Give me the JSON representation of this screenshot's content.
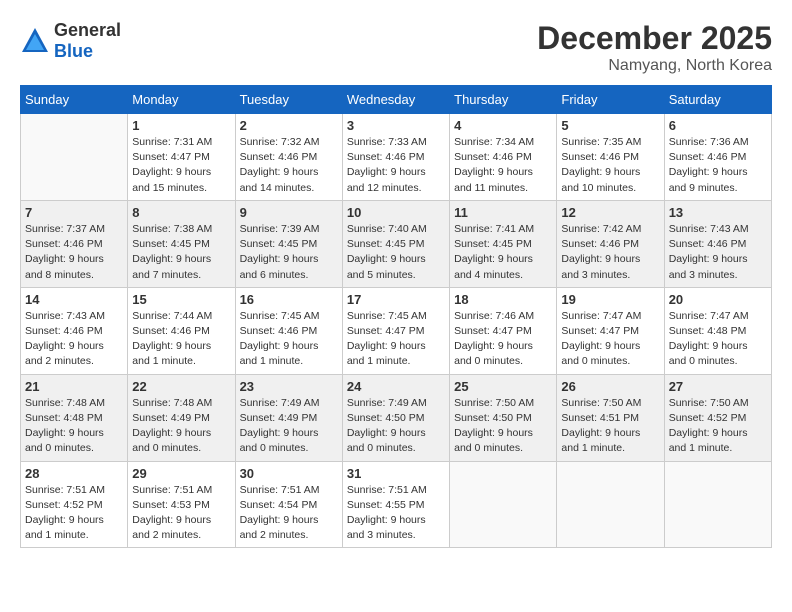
{
  "header": {
    "logo_line1": "General",
    "logo_line2": "Blue",
    "month_title": "December 2025",
    "location": "Namyang, North Korea"
  },
  "weekdays": [
    "Sunday",
    "Monday",
    "Tuesday",
    "Wednesday",
    "Thursday",
    "Friday",
    "Saturday"
  ],
  "weeks": [
    [
      {
        "day": "",
        "info": ""
      },
      {
        "day": "1",
        "info": "Sunrise: 7:31 AM\nSunset: 4:47 PM\nDaylight: 9 hours\nand 15 minutes."
      },
      {
        "day": "2",
        "info": "Sunrise: 7:32 AM\nSunset: 4:46 PM\nDaylight: 9 hours\nand 14 minutes."
      },
      {
        "day": "3",
        "info": "Sunrise: 7:33 AM\nSunset: 4:46 PM\nDaylight: 9 hours\nand 12 minutes."
      },
      {
        "day": "4",
        "info": "Sunrise: 7:34 AM\nSunset: 4:46 PM\nDaylight: 9 hours\nand 11 minutes."
      },
      {
        "day": "5",
        "info": "Sunrise: 7:35 AM\nSunset: 4:46 PM\nDaylight: 9 hours\nand 10 minutes."
      },
      {
        "day": "6",
        "info": "Sunrise: 7:36 AM\nSunset: 4:46 PM\nDaylight: 9 hours\nand 9 minutes."
      }
    ],
    [
      {
        "day": "7",
        "info": "Sunrise: 7:37 AM\nSunset: 4:46 PM\nDaylight: 9 hours\nand 8 minutes."
      },
      {
        "day": "8",
        "info": "Sunrise: 7:38 AM\nSunset: 4:45 PM\nDaylight: 9 hours\nand 7 minutes."
      },
      {
        "day": "9",
        "info": "Sunrise: 7:39 AM\nSunset: 4:45 PM\nDaylight: 9 hours\nand 6 minutes."
      },
      {
        "day": "10",
        "info": "Sunrise: 7:40 AM\nSunset: 4:45 PM\nDaylight: 9 hours\nand 5 minutes."
      },
      {
        "day": "11",
        "info": "Sunrise: 7:41 AM\nSunset: 4:45 PM\nDaylight: 9 hours\nand 4 minutes."
      },
      {
        "day": "12",
        "info": "Sunrise: 7:42 AM\nSunset: 4:46 PM\nDaylight: 9 hours\nand 3 minutes."
      },
      {
        "day": "13",
        "info": "Sunrise: 7:43 AM\nSunset: 4:46 PM\nDaylight: 9 hours\nand 3 minutes."
      }
    ],
    [
      {
        "day": "14",
        "info": "Sunrise: 7:43 AM\nSunset: 4:46 PM\nDaylight: 9 hours\nand 2 minutes."
      },
      {
        "day": "15",
        "info": "Sunrise: 7:44 AM\nSunset: 4:46 PM\nDaylight: 9 hours\nand 1 minute."
      },
      {
        "day": "16",
        "info": "Sunrise: 7:45 AM\nSunset: 4:46 PM\nDaylight: 9 hours\nand 1 minute."
      },
      {
        "day": "17",
        "info": "Sunrise: 7:45 AM\nSunset: 4:47 PM\nDaylight: 9 hours\nand 1 minute."
      },
      {
        "day": "18",
        "info": "Sunrise: 7:46 AM\nSunset: 4:47 PM\nDaylight: 9 hours\nand 0 minutes."
      },
      {
        "day": "19",
        "info": "Sunrise: 7:47 AM\nSunset: 4:47 PM\nDaylight: 9 hours\nand 0 minutes."
      },
      {
        "day": "20",
        "info": "Sunrise: 7:47 AM\nSunset: 4:48 PM\nDaylight: 9 hours\nand 0 minutes."
      }
    ],
    [
      {
        "day": "21",
        "info": "Sunrise: 7:48 AM\nSunset: 4:48 PM\nDaylight: 9 hours\nand 0 minutes."
      },
      {
        "day": "22",
        "info": "Sunrise: 7:48 AM\nSunset: 4:49 PM\nDaylight: 9 hours\nand 0 minutes."
      },
      {
        "day": "23",
        "info": "Sunrise: 7:49 AM\nSunset: 4:49 PM\nDaylight: 9 hours\nand 0 minutes."
      },
      {
        "day": "24",
        "info": "Sunrise: 7:49 AM\nSunset: 4:50 PM\nDaylight: 9 hours\nand 0 minutes."
      },
      {
        "day": "25",
        "info": "Sunrise: 7:50 AM\nSunset: 4:50 PM\nDaylight: 9 hours\nand 0 minutes."
      },
      {
        "day": "26",
        "info": "Sunrise: 7:50 AM\nSunset: 4:51 PM\nDaylight: 9 hours\nand 1 minute."
      },
      {
        "day": "27",
        "info": "Sunrise: 7:50 AM\nSunset: 4:52 PM\nDaylight: 9 hours\nand 1 minute."
      }
    ],
    [
      {
        "day": "28",
        "info": "Sunrise: 7:51 AM\nSunset: 4:52 PM\nDaylight: 9 hours\nand 1 minute."
      },
      {
        "day": "29",
        "info": "Sunrise: 7:51 AM\nSunset: 4:53 PM\nDaylight: 9 hours\nand 2 minutes."
      },
      {
        "day": "30",
        "info": "Sunrise: 7:51 AM\nSunset: 4:54 PM\nDaylight: 9 hours\nand 2 minutes."
      },
      {
        "day": "31",
        "info": "Sunrise: 7:51 AM\nSunset: 4:55 PM\nDaylight: 9 hours\nand 3 minutes."
      },
      {
        "day": "",
        "info": ""
      },
      {
        "day": "",
        "info": ""
      },
      {
        "day": "",
        "info": ""
      }
    ]
  ]
}
